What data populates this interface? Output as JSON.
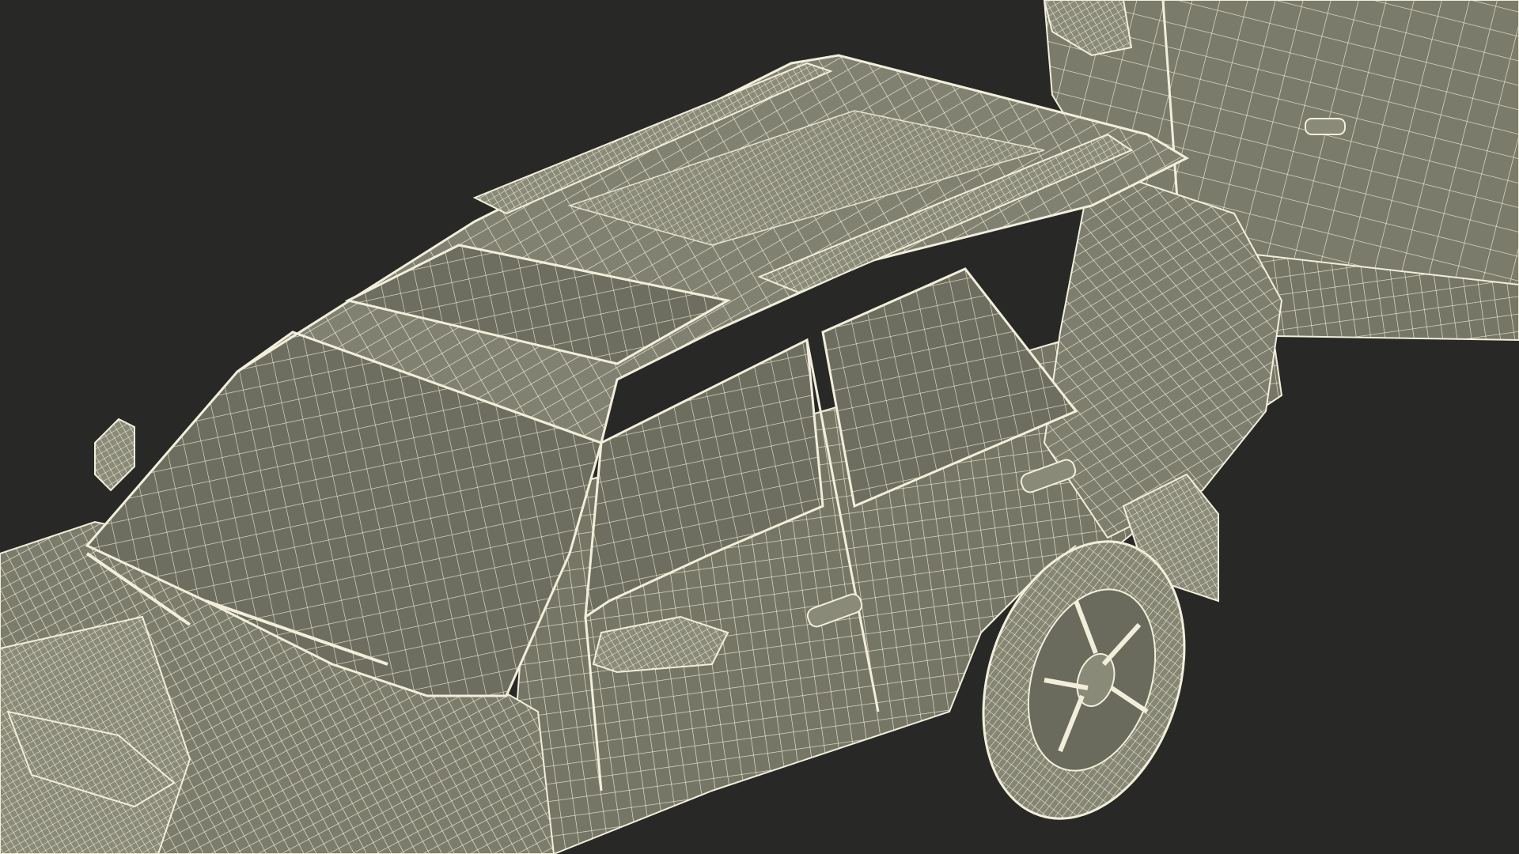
{
  "scene": {
    "subject": "suv-with-trailer-wireframe",
    "colors": {
      "background": "#282826",
      "mesh_fill": "#7c7c6c",
      "mesh_fill_dark": "#5f5f52",
      "mesh_fill_light": "#8f8f7e",
      "wire": "#f1eedb",
      "wire_dense": "#e8e4cc",
      "shadow": "#3a3a34"
    }
  }
}
